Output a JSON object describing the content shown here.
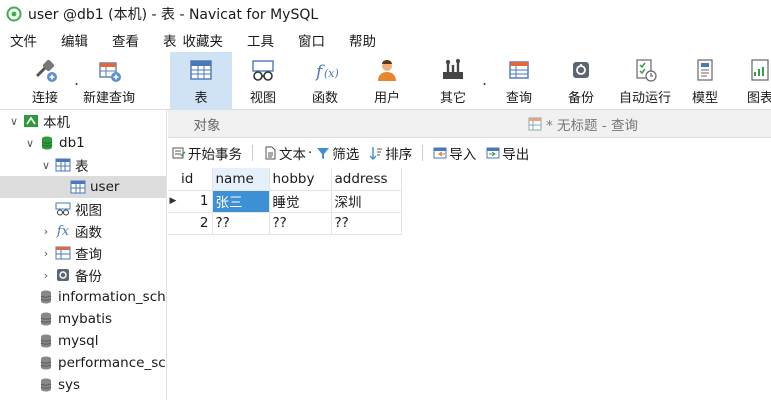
{
  "window": {
    "title": "user @db1 (本机) - 表 - Navicat for MySQL"
  },
  "menu": [
    "文件",
    "编辑",
    "查看",
    "表",
    "收藏夹",
    "工具",
    "窗口",
    "帮助"
  ],
  "toolbar": {
    "items": [
      {
        "label": "连接",
        "icon": "connect-icon"
      },
      {
        "label": "新建查询",
        "icon": "new-query-icon"
      },
      {
        "label": "表",
        "icon": "table-icon",
        "active": true
      },
      {
        "label": "视图",
        "icon": "view-icon"
      },
      {
        "label": "函数",
        "icon": "function-icon"
      },
      {
        "label": "用户",
        "icon": "user-icon"
      },
      {
        "label": "其它",
        "icon": "other-icon"
      },
      {
        "label": "查询",
        "icon": "query-icon"
      },
      {
        "label": "备份",
        "icon": "backup-icon"
      },
      {
        "label": "自动运行",
        "icon": "auto-run-icon"
      },
      {
        "label": "模型",
        "icon": "model-icon"
      },
      {
        "label": "图表",
        "icon": "chart-icon"
      }
    ]
  },
  "nav": {
    "connection": "本机",
    "database": "db1",
    "tables_group": "表",
    "table_user": "user",
    "views": "视图",
    "functions": "函数",
    "queries": "查询",
    "backups": "备份",
    "other_dbs": [
      "information_schema",
      "mybatis",
      "mysql",
      "performance_schema",
      "sys"
    ]
  },
  "tabs": {
    "objects": "对象",
    "query": "* 无标题 - 查询"
  },
  "grid_toolbar": {
    "begin_transaction": "开始事务",
    "text": "文本",
    "filter": "筛选",
    "sort": "排序",
    "import": "导入",
    "export": "导出"
  },
  "table": {
    "columns": [
      "id",
      "name",
      "hobby",
      "address"
    ],
    "rows": [
      {
        "id": "1",
        "name": "张三",
        "hobby": "睡觉",
        "address": "深圳"
      },
      {
        "id": "2",
        "name": "??",
        "hobby": "??",
        "address": "??"
      }
    ]
  },
  "colors": {
    "selection": "#3d8fd6",
    "toolbar_active": "#cfe3f5",
    "db_icon": "#2e9b3a"
  }
}
